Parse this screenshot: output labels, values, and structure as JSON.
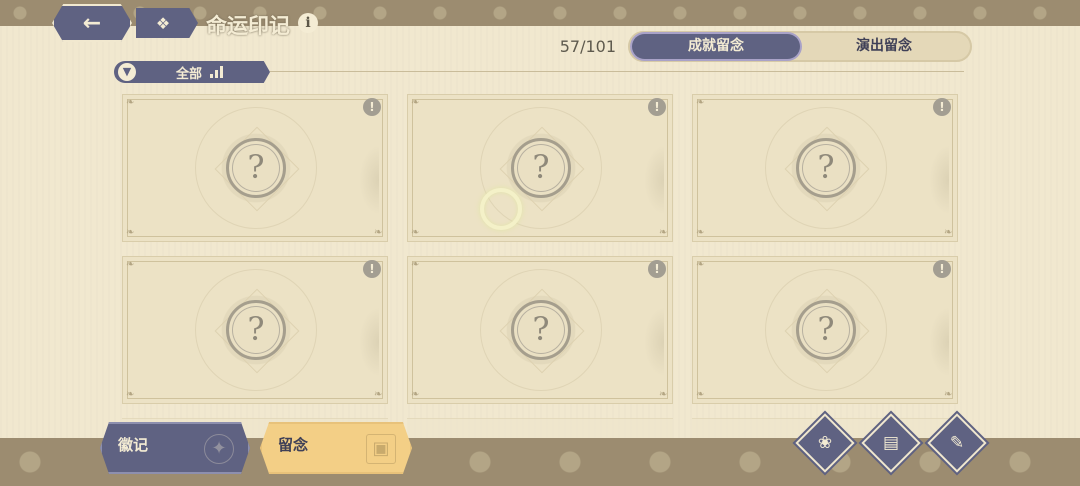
{
  "header": {
    "back_icon": "arrow-left-icon",
    "menu_icon": "grid-icon",
    "title": "命运印记",
    "info_icon": "info-icon"
  },
  "progress": {
    "count": "57/101"
  },
  "tabs": [
    {
      "label": "成就留念",
      "active": true
    },
    {
      "label": "演出留念",
      "active": false
    }
  ],
  "filter": {
    "icon": "filter-icon",
    "label": "全部",
    "sort_icon": "signal-bars-icon"
  },
  "cards": [
    {
      "symbol": "?",
      "alert": "!"
    },
    {
      "symbol": "?",
      "alert": "!"
    },
    {
      "symbol": "?",
      "alert": "!"
    },
    {
      "symbol": "?",
      "alert": "!"
    },
    {
      "symbol": "?",
      "alert": "!"
    },
    {
      "symbol": "?",
      "alert": "!"
    }
  ],
  "bottom_nav": [
    {
      "label": "徽记",
      "active": false,
      "icon": "emblem-icon"
    },
    {
      "label": "留念",
      "active": true,
      "icon": "photo-icon"
    }
  ],
  "actions": [
    {
      "icon": "flower-icon"
    },
    {
      "icon": "book-icon"
    },
    {
      "icon": "scroll-icon"
    }
  ],
  "colors": {
    "accent": "#5f6282",
    "highlight": "#f3cf86",
    "background": "#f1e8cf",
    "band": "#9c8c70"
  }
}
